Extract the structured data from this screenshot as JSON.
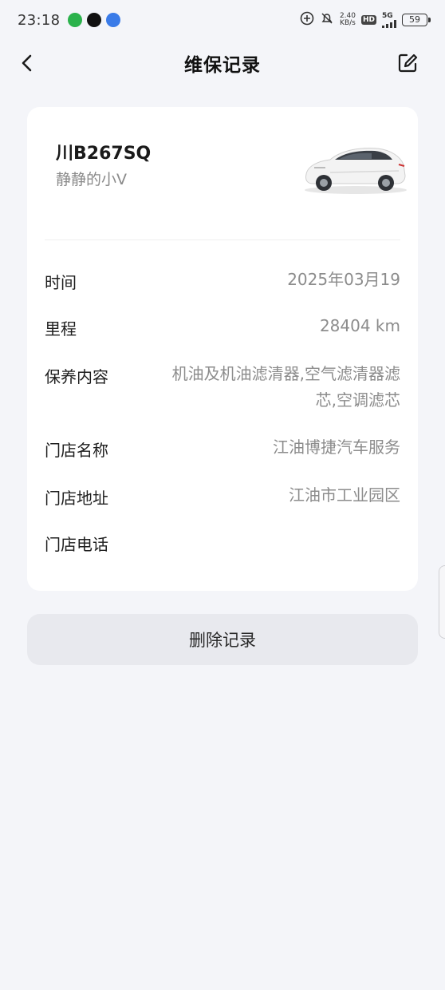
{
  "status_bar": {
    "time": "23:18",
    "apps": [
      "wechat-icon",
      "tiktok-icon",
      "blue-app-icon"
    ],
    "speed_top": "2.40",
    "speed_bottom": "KB/s",
    "hd": "HD",
    "network": "5G",
    "battery": "59"
  },
  "nav": {
    "title": "维保记录",
    "back_icon": "chevron-left-icon",
    "edit_icon": "edit-icon"
  },
  "vehicle": {
    "plate": "川B267SQ",
    "nickname": "静静的小V"
  },
  "details": [
    {
      "label": "时间",
      "value": "2025年03月19"
    },
    {
      "label": "里程",
      "value": "28404 km"
    },
    {
      "label": "保养内容",
      "value": "机油及机油滤清器,空气滤清器滤芯,空调滤芯"
    },
    {
      "label": "门店名称",
      "value": "江油博捷汽车服务"
    },
    {
      "label": "门店地址",
      "value": "江油市工业园区"
    },
    {
      "label": "门店电话",
      "value": ""
    }
  ],
  "actions": {
    "delete_label": "删除记录"
  },
  "colors": {
    "background": "#f4f5f9",
    "card": "#ffffff",
    "button": "#e8e9ee",
    "muted_text": "#8c8c8c"
  }
}
